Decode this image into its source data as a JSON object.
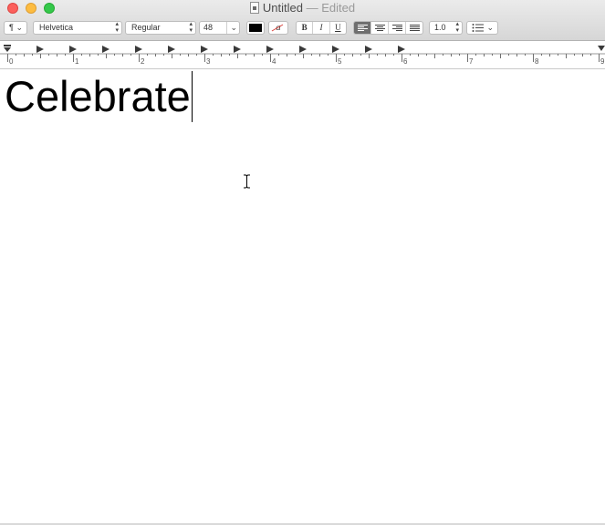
{
  "window": {
    "title": "Untitled",
    "separator": "—",
    "status": "Edited",
    "colors": {
      "close": "#fc605c",
      "minimize": "#fdbc40",
      "zoom": "#34c84a",
      "text_color": "#000000",
      "active_segment": "#6e6e6e"
    }
  },
  "toolbar": {
    "paragraph_style": {
      "label": "¶",
      "icon": "chevron-down-icon"
    },
    "font_family": "Helvetica",
    "typeface": "Regular",
    "font_size": "48",
    "text_color_icon": "color-swatch-icon",
    "highlight_icon": "highlight-a-icon",
    "bold_label": "B",
    "italic_label": "I",
    "underline_label": "U",
    "alignment": {
      "options": [
        "align-left-icon",
        "align-center-icon",
        "align-right-icon",
        "justify-icon"
      ],
      "selected": "align-left-icon"
    },
    "line_spacing": "1.0",
    "list_icon": "bullet-list-icon"
  },
  "ruler": {
    "labels": [
      "0",
      "1",
      "2",
      "3",
      "4",
      "5",
      "6",
      "7",
      "8",
      "9"
    ]
  },
  "document": {
    "text": "Celebrate"
  }
}
